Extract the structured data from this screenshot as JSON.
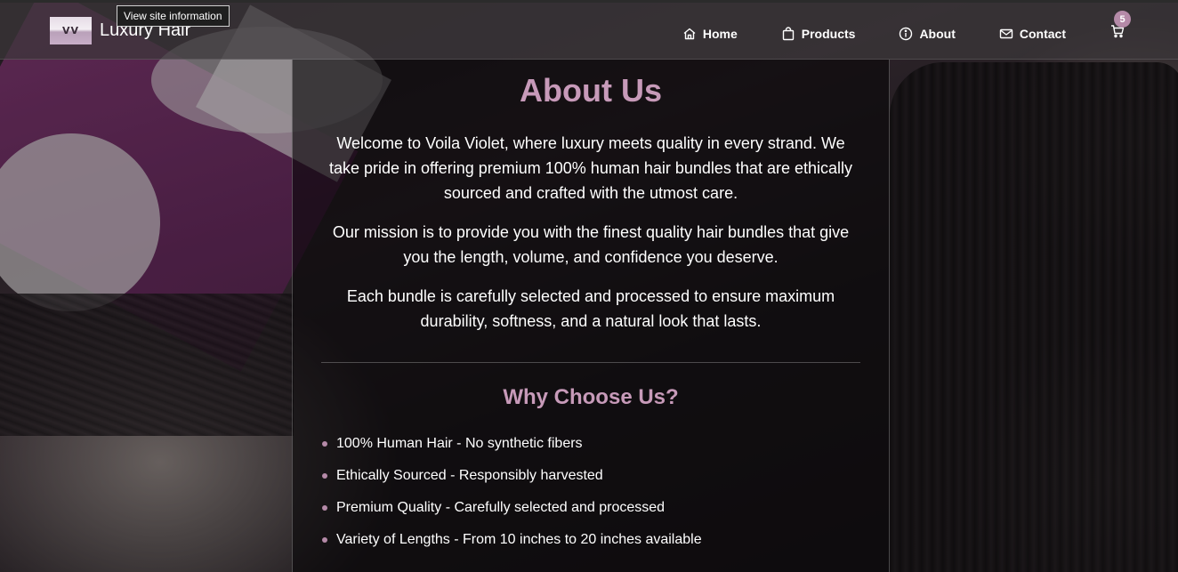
{
  "tooltip": "View site information",
  "brand": {
    "logo_text": "VV",
    "name": "Luxury Hair"
  },
  "nav": {
    "items": [
      {
        "label": "Home",
        "icon": "home-icon"
      },
      {
        "label": "Products",
        "icon": "shopping-bag-icon"
      },
      {
        "label": "About",
        "icon": "info-icon"
      },
      {
        "label": "Contact",
        "icon": "mail-icon"
      }
    ],
    "cart_count": "5"
  },
  "about": {
    "title": "About Us",
    "paragraphs": [
      "Welcome to Voila Violet, where luxury meets quality in every strand. We take pride in offering premium 100% human hair bundles that are ethically sourced and crafted with the utmost care.",
      "Our mission is to provide you with the finest quality hair bundles that give you the length, volume, and confidence you deserve.",
      "Each bundle is carefully selected and processed to ensure maximum durability, softness, and a natural look that lasts."
    ],
    "why_title": "Why Choose Us?",
    "features": [
      "100% Human Hair - No synthetic fibers",
      "Ethically Sourced - Responsibly harvested",
      "Premium Quality - Carefully selected and processed",
      "Variety of Lengths - From 10 inches to 20 inches available"
    ]
  },
  "colors": {
    "accent": "#c79ab9",
    "badge": "#b58aa8"
  }
}
